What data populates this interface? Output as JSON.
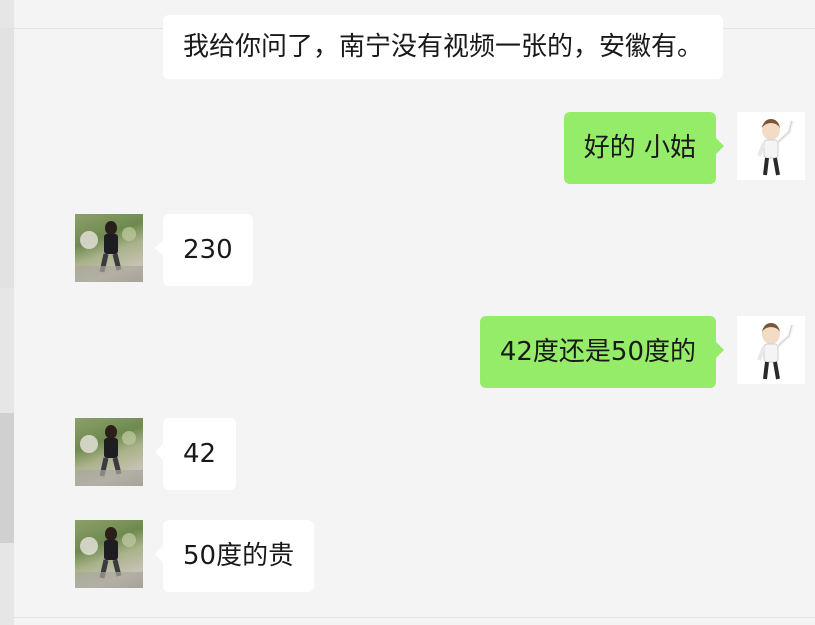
{
  "messages": [
    {
      "side": "in",
      "text": "我给你问了，南宁没有视频一张的，安徽有。"
    },
    {
      "side": "out",
      "text": "好的 小姑"
    },
    {
      "side": "in",
      "text": "230"
    },
    {
      "side": "out",
      "text": "42度还是50度的"
    },
    {
      "side": "in",
      "text": "42"
    },
    {
      "side": "in",
      "text": "50度的贵"
    }
  ],
  "colors": {
    "background": "#f4f4f4",
    "incoming_bubble": "#ffffff",
    "outgoing_bubble": "#95ec69"
  },
  "icons": {
    "contact_avatar": "avatar-photo-icon",
    "self_avatar": "avatar-cartoon-icon"
  }
}
